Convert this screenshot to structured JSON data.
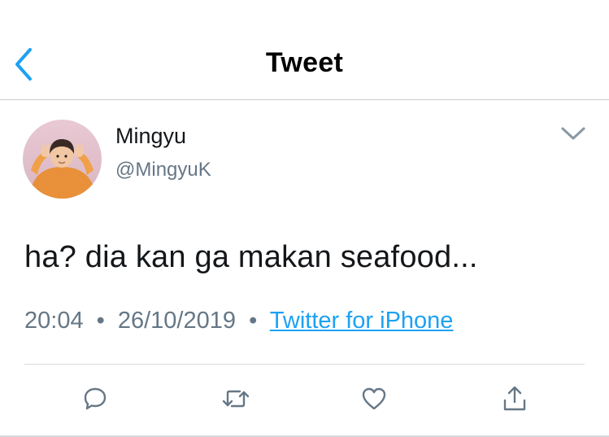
{
  "header": {
    "title": "Tweet",
    "back_icon": "chevron-left-icon"
  },
  "tweet": {
    "author_name": "Mingyu",
    "author_handle": "@MingyuK",
    "text": "ha? dia kan ga makan seafood...",
    "time": "20:04",
    "date": "26/10/2019",
    "separator": "•",
    "source": "Twitter for iPhone"
  },
  "actions": [
    {
      "name": "reply",
      "icon": "reply-icon"
    },
    {
      "name": "retweet",
      "icon": "retweet-icon"
    },
    {
      "name": "like",
      "icon": "heart-icon"
    },
    {
      "name": "share",
      "icon": "share-icon"
    }
  ],
  "colors": {
    "accent": "#1da1f2",
    "text_primary": "#14171a",
    "text_secondary": "#657786",
    "divider": "#d6dbdf"
  }
}
